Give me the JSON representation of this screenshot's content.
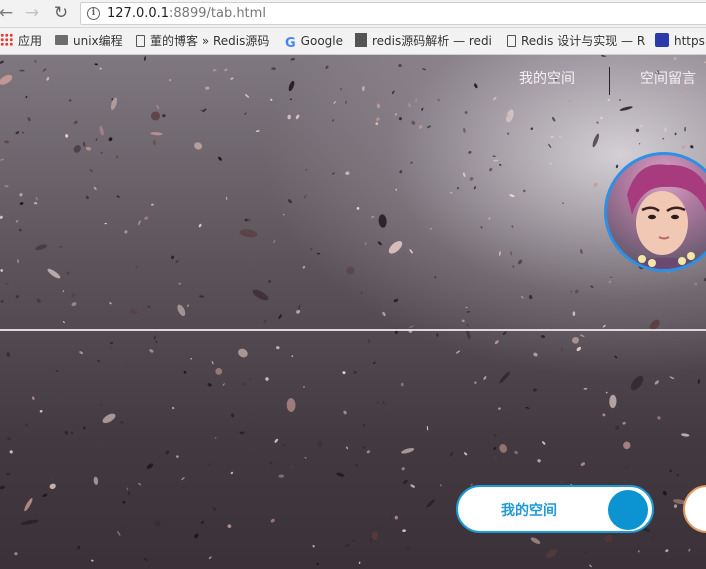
{
  "browser": {
    "url_host": "127.0.0.1",
    "url_rest": ":8899/tab.html"
  },
  "bookmarks": [
    {
      "label": "应用",
      "icon": "apps-icon"
    },
    {
      "label": "unix编程",
      "icon": "folder-icon"
    },
    {
      "label": "董的博客 » Redis源码",
      "icon": "page-icon"
    },
    {
      "label": "Google",
      "icon": "google-icon"
    },
    {
      "label": "redis源码解析 — redi",
      "icon": "book-icon"
    },
    {
      "label": "Redis 设计与实现 — R",
      "icon": "page-icon"
    },
    {
      "label": "https:",
      "icon": "baidu-paw-icon"
    }
  ],
  "page": {
    "nav": {
      "my_space": "我的空间",
      "space_messages": "空间留言"
    },
    "toggle": {
      "label": "我的空间"
    }
  },
  "colors": {
    "accent_blue": "#1f9ad6",
    "avatar_border": "#2d8fe6",
    "second_toggle_border": "#e09a60"
  }
}
